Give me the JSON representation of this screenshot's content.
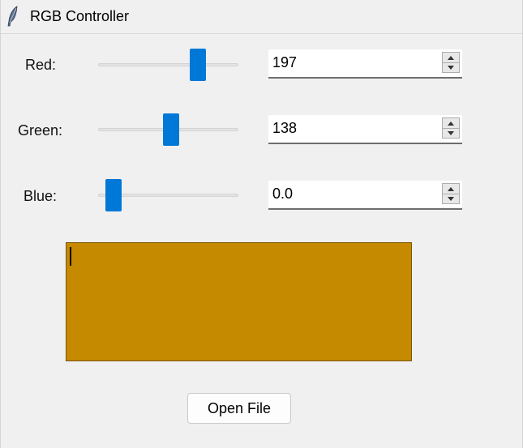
{
  "window": {
    "title": "RGB Controller",
    "icon": "feather-icon"
  },
  "controls": [
    {
      "key": "red",
      "label": "Red:",
      "value": "197",
      "slider_fraction": 0.74
    },
    {
      "key": "green",
      "label": "Green:",
      "value": "138",
      "slider_fraction": 0.52
    },
    {
      "key": "blue",
      "label": "Blue:",
      "value": "0.0",
      "slider_fraction": 0.06
    }
  ],
  "preview": {
    "color": "#c58a00"
  },
  "open_button": {
    "label": "Open File"
  },
  "colors": {
    "accent": "#0078d7",
    "background": "#f0f0f0"
  }
}
